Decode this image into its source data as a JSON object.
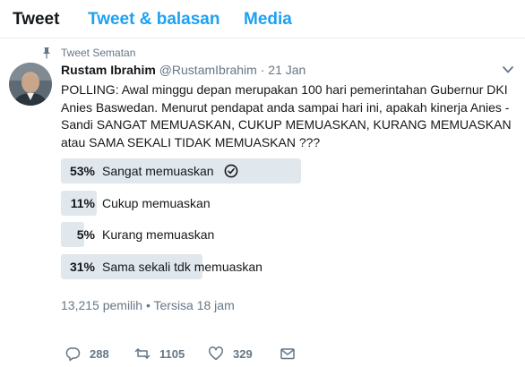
{
  "tabs": [
    {
      "label": "Tweet",
      "active": true
    },
    {
      "label": "Tweet & balasan",
      "active": false
    },
    {
      "label": "Media",
      "active": false
    }
  ],
  "pinned_label": "Tweet Sematan",
  "tweet": {
    "name": "Rustam Ibrahim",
    "handle": "@RustamIbrahim",
    "separator": "·",
    "date": "21 Jan",
    "text": "POLLING: Awal minggu depan merupakan 100 hari pemerintahan Gubernur DKI Anies Baswedan. Menurut pendapat anda sampai hari ini, apakah kinerja Anies - Sandi SANGAT MEMUASKAN, CUKUP MEMUASKAN, KURANG MEMUASKAN atau SAMA SEKALI TIDAK MEMUASKAN ???"
  },
  "poll": {
    "choices": [
      {
        "percent": "53%",
        "value": 53,
        "label": "Sangat memuaskan",
        "winner": true
      },
      {
        "percent": "11%",
        "value": 11,
        "label": "Cukup memuaskan",
        "winner": false
      },
      {
        "percent": "5%",
        "value": 5,
        "label": "Kurang memuaskan",
        "winner": false
      },
      {
        "percent": "31%",
        "value": 31,
        "label": "Sama sekali tdk memuaskan",
        "winner": false
      }
    ],
    "meta": "13,215 pemilih • Tersisa 18 jam"
  },
  "actions": {
    "replies": "288",
    "retweets": "1105",
    "likes": "329"
  },
  "colors": {
    "accent": "#1da1f2",
    "bar": "#e1e8ed",
    "muted": "#657786",
    "text": "#14171a"
  }
}
